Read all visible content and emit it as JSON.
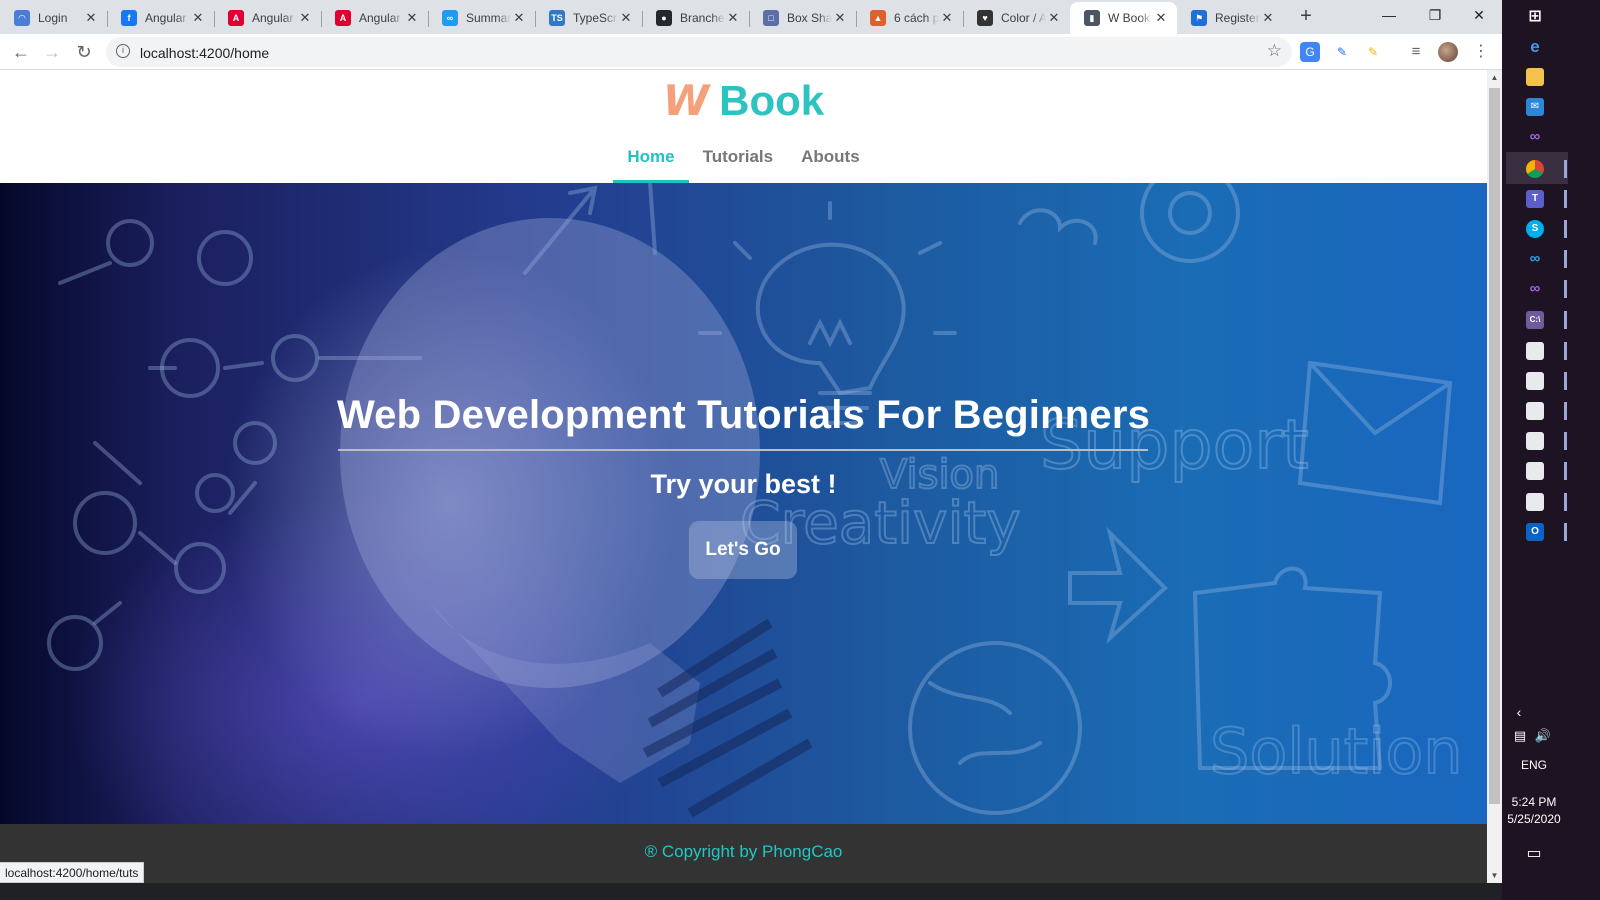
{
  "browser": {
    "tabs": [
      {
        "title": "Login",
        "icon": "loading-icon",
        "color": "#4a7cd8"
      },
      {
        "title": "Angular",
        "icon": "facebook-icon",
        "color": "#1877f2"
      },
      {
        "title": "Angular",
        "icon": "angular-icon",
        "color": "#dd0031"
      },
      {
        "title": "Angular",
        "icon": "angular-icon",
        "color": "#dd0031"
      },
      {
        "title": "Summar",
        "icon": "vscode-icon",
        "color": "#1f9cf0"
      },
      {
        "title": "TypeScr",
        "icon": "typescript-icon",
        "color": "#3178c6"
      },
      {
        "title": "Branche",
        "icon": "github-icon",
        "color": "#24292e"
      },
      {
        "title": "Box Sha",
        "icon": "page-icon",
        "color": "#5a6ea8"
      },
      {
        "title": "6 cách p",
        "icon": "colorful-icon",
        "color": "#e0602c"
      },
      {
        "title": "Color / A",
        "icon": "heart-icon",
        "color": "#333333"
      },
      {
        "title": "W Book",
        "icon": "book-icon",
        "color": "#4b5563",
        "active": true
      },
      {
        "title": "Register",
        "icon": "flag-icon",
        "color": "#1e6fd9"
      }
    ],
    "url": "localhost:4200/home",
    "status_url": "localhost:4200/home/tuts"
  },
  "site": {
    "logo_w": "W",
    "logo_name": "Book",
    "nav": [
      {
        "label": "Home",
        "active": true
      },
      {
        "label": "Tutorials",
        "active": false
      },
      {
        "label": "Abouts",
        "active": false
      }
    ],
    "hero": {
      "title": "Web Development Tutorials For Beginners",
      "subtitle": "Try your best !",
      "cta": "Let's Go",
      "background_words": [
        "Support",
        "Vision",
        "Creativity",
        "Solution"
      ]
    },
    "footer": {
      "symbol": "®",
      "text": "Copyright by PhongCao"
    },
    "colors": {
      "accent": "#22c1c3",
      "logo_w": "#f4a07a",
      "footer_bg": "#333333"
    }
  },
  "taskbar": {
    "language": "ENG",
    "time": "5:24 PM",
    "date": "5/25/2020"
  }
}
